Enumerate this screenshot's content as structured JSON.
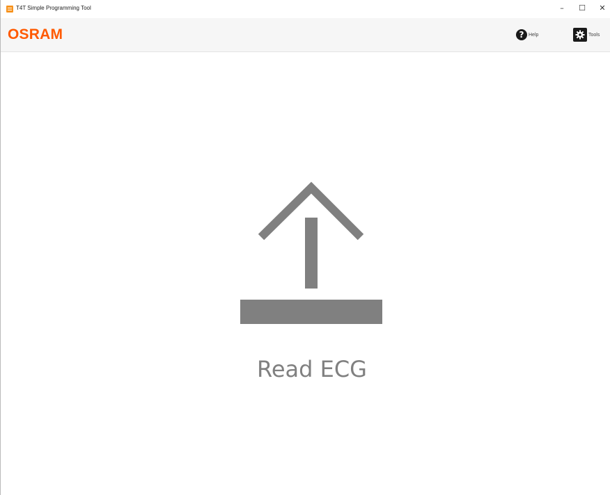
{
  "window": {
    "title": "T4T Simple Programming Tool",
    "minimize_glyph": "–",
    "maximize_glyph": "☐",
    "close_glyph": "✕"
  },
  "header": {
    "logo": "OSRAM",
    "help": {
      "label": "Help",
      "icon": "question-circle-icon",
      "glyph": "?"
    },
    "tools": {
      "label": "Tools",
      "icon": "gear-icon"
    }
  },
  "main": {
    "action": {
      "label": "Read ECG",
      "icon": "upload-arrow-icon"
    }
  },
  "colors": {
    "brand": "#ff5a00",
    "icon_gray": "#808080",
    "header_bg": "#f6f6f6"
  }
}
